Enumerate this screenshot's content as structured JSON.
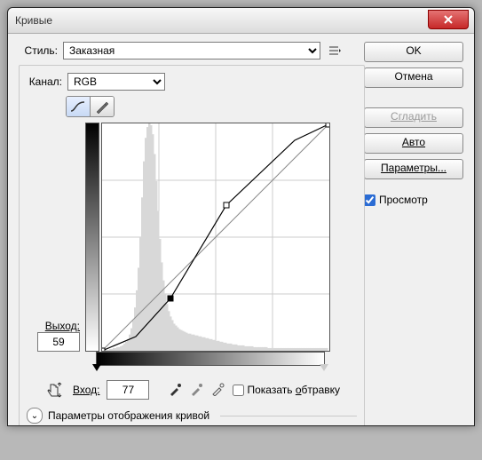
{
  "window": {
    "title": "Кривые"
  },
  "style": {
    "label": "Стиль:",
    "value": "Заказная"
  },
  "channel": {
    "label": "Канал:",
    "value": "RGB"
  },
  "output": {
    "label": "Выход:",
    "value": "59"
  },
  "input": {
    "label": "Вход:",
    "value": "77"
  },
  "show_clipping": {
    "label": "Показать обтравку",
    "checked": false
  },
  "disclosure": {
    "label": "Параметры отображения кривой"
  },
  "buttons": {
    "ok": "OK",
    "cancel": "Отмена",
    "smooth": "Сгладить",
    "auto": "Авто",
    "options": "Параметры..."
  },
  "preview": {
    "label": "Просмотр",
    "checked": true
  },
  "chart_data": {
    "type": "line",
    "title": "",
    "xlabel": "Вход",
    "ylabel": "Выход",
    "xlim": [
      0,
      255
    ],
    "ylim": [
      0,
      255
    ],
    "series": [
      {
        "name": "baseline",
        "x": [
          0,
          255
        ],
        "y": [
          0,
          255
        ]
      },
      {
        "name": "curve",
        "x": [
          0,
          38,
          77,
          140,
          217,
          255
        ],
        "y": [
          0,
          16,
          59,
          164,
          237,
          255
        ]
      }
    ],
    "control_points": [
      {
        "x": 0,
        "y": 0
      },
      {
        "x": 77,
        "y": 59
      },
      {
        "x": 140,
        "y": 164
      },
      {
        "x": 255,
        "y": 255
      }
    ],
    "histogram": [
      0,
      0,
      1,
      1,
      2,
      2,
      3,
      3,
      4,
      4,
      5,
      6,
      8,
      10,
      13,
      18,
      25,
      34,
      48,
      67,
      92,
      126,
      170,
      210,
      236,
      248,
      252,
      250,
      240,
      218,
      188,
      155,
      124,
      98,
      78,
      63,
      52,
      44,
      38,
      34,
      30,
      28,
      26,
      24,
      23,
      22,
      21,
      20,
      19,
      19,
      18,
      18,
      17,
      17,
      16,
      16,
      15,
      15,
      14,
      14,
      13,
      13,
      12,
      12,
      11,
      11,
      10,
      10,
      9,
      9,
      8,
      8,
      8,
      7,
      7,
      7,
      6,
      6,
      6,
      6,
      5,
      5,
      5,
      5,
      5,
      4,
      4,
      4,
      4,
      4,
      4,
      4,
      4,
      3,
      3,
      3,
      3,
      3,
      3,
      3,
      3,
      3,
      3,
      3,
      3,
      3,
      3,
      3,
      3,
      3,
      3,
      3,
      3,
      3,
      3,
      3,
      3,
      3,
      3,
      3,
      3,
      3,
      3,
      3,
      3,
      3,
      3,
      0
    ]
  }
}
